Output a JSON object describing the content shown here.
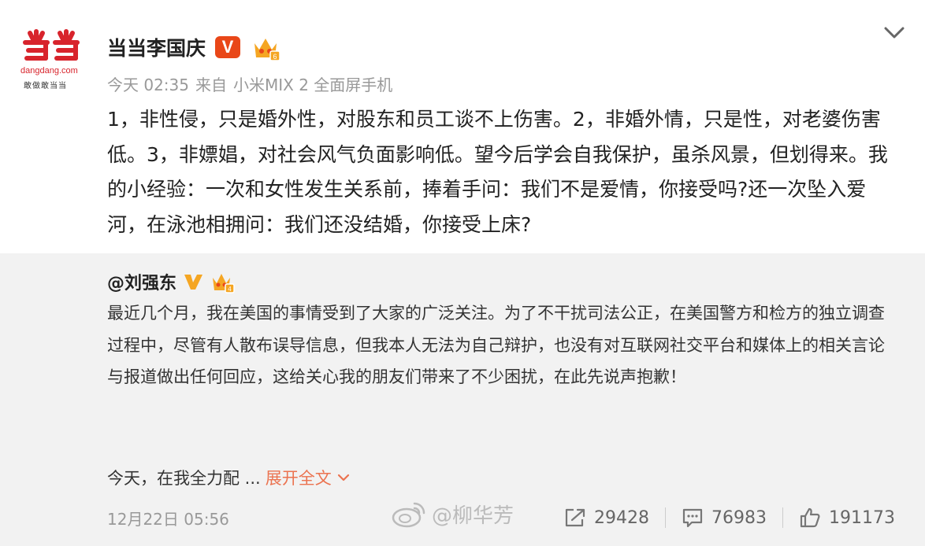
{
  "avatar": {
    "site": "dangdang.com",
    "slogan": "敢做敢当当",
    "brand_color": "#d8242c"
  },
  "author": {
    "name": "当当李国庆",
    "verified_badge": "V",
    "crown_icon": "crown-icon"
  },
  "meta": {
    "time": "今天 02:35",
    "from_label": "来自",
    "device": "小米MIX 2 全面屏手机"
  },
  "post": {
    "text": "1，非性侵，只是婚外性，对股东和员工谈不上伤害。2，非婚外情，只是性，对老婆伤害低。3，非嫖娼，对社会风气负面影响低。望今后学会自我保护，虽杀风景，但划得来。我的小经验：一次和女性发生关系前，捧着手问：我们不是爱情，你接受吗?还一次坠入爱河，在泳池相拥问：我们还没结婚，你接受上床?"
  },
  "repost": {
    "author": "@刘强东",
    "verified_badge": "V",
    "text": "最近几个月，我在美国的事情受到了大家的广泛关注。为了不干扰司法公正，在美国警方和检方的独立调查过程中，尽管有人散布误导信息，但我本人无法为自己辩护，也没有对互联网社交平台和媒体上的相关言论与报道做出任何回应，这给关心我的朋友们带来了不少困扰，在此先说声抱歉！",
    "more_text": "今天，在我全力配 ...",
    "expand_label": "展开全文",
    "date": "12月22日 05:56",
    "watermark": "@柳华芳",
    "reposts": "29428",
    "comments": "76983",
    "likes": "191173"
  },
  "colors": {
    "accent": "#eb7350",
    "verified_orange": "#e94718",
    "verified_gold": "#f5a623"
  }
}
